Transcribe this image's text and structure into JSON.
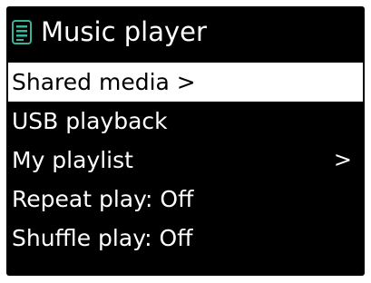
{
  "header": {
    "title": "Music player",
    "icon": "music-list-icon",
    "icon_color": "#3bb39a"
  },
  "menu": {
    "items": [
      {
        "label": "Shared media >",
        "arrow": "",
        "selected": true
      },
      {
        "label": "USB playback",
        "arrow": "",
        "selected": false
      },
      {
        "label": "My playlist",
        "arrow": ">",
        "selected": false
      },
      {
        "label": "Repeat play: Off",
        "arrow": "",
        "selected": false
      },
      {
        "label": "Shuffle play: Off",
        "arrow": "",
        "selected": false
      }
    ]
  },
  "colors": {
    "screen_background": "#000000",
    "text": "#ffffff",
    "highlight_background": "#ffffff",
    "highlight_text": "#000000"
  }
}
